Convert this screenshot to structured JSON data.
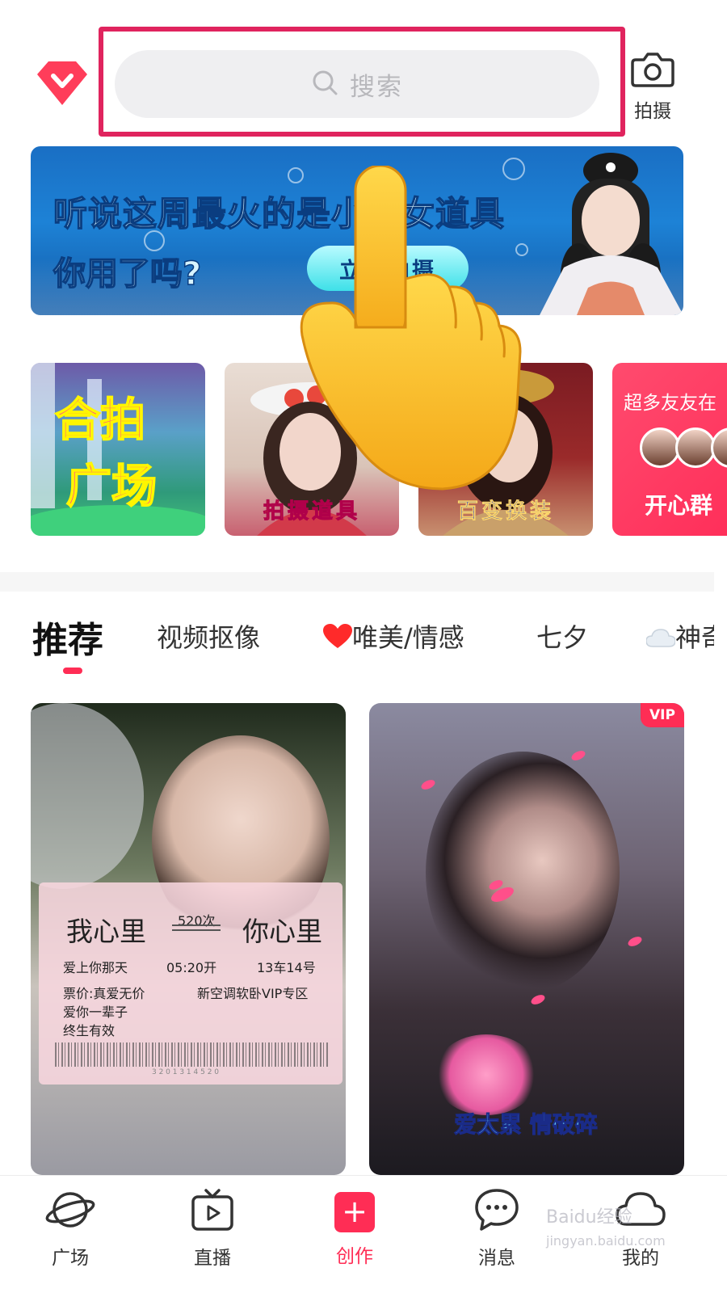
{
  "header": {
    "search_placeholder": "搜索",
    "camera_label": "拍摄",
    "highlight_color": "#e0245e"
  },
  "banner": {
    "line1": "听说这周最火的是小龙女道具",
    "line2": "你用了吗?",
    "cta_label": "立即拍摄"
  },
  "shortcuts": {
    "card1_line1": "合拍",
    "card1_line2": "广场",
    "card2_caption": "拍摄道具",
    "card3_caption": "百变换装",
    "card4_top": "超多友友在",
    "card4_bottom": "开心群"
  },
  "tabs": [
    {
      "label": "推荐",
      "active": true
    },
    {
      "label": "视频抠像"
    },
    {
      "label": "唯美/情感",
      "icon": "heart-icon"
    },
    {
      "label": "七夕"
    },
    {
      "label": "神奇",
      "icon": "cloud-icon"
    }
  ],
  "feed": {
    "card1": {
      "left_big": "我心里",
      "right_big": "你心里",
      "count": "520次",
      "left_sub": "爱上你那天",
      "time": "05:20开",
      "seat": "13车14号",
      "price": "票价:真爱无价",
      "forever": "爱你一辈子",
      "valid": "终生有效",
      "zone": "新空调软卧VIP专区",
      "barcode_number": "3 2 0 1 3 1 4 5 2 0"
    },
    "card2": {
      "badge": "VIP",
      "caption": "爱太累 情破碎"
    }
  },
  "bottom_nav": [
    {
      "label": "广场",
      "icon": "planet-icon"
    },
    {
      "label": "直播",
      "icon": "tv-icon"
    },
    {
      "label": "创作",
      "icon": "plus-icon",
      "active": true
    },
    {
      "label": "消息",
      "icon": "chat-icon"
    },
    {
      "label": "我的",
      "icon": "cloud-profile-icon"
    }
  ],
  "watermark": {
    "line1": "Baidu经验",
    "line2": "jingyan.baidu.com"
  },
  "colors": {
    "accent": "#ff2d55",
    "search_bg": "#efeff1"
  }
}
